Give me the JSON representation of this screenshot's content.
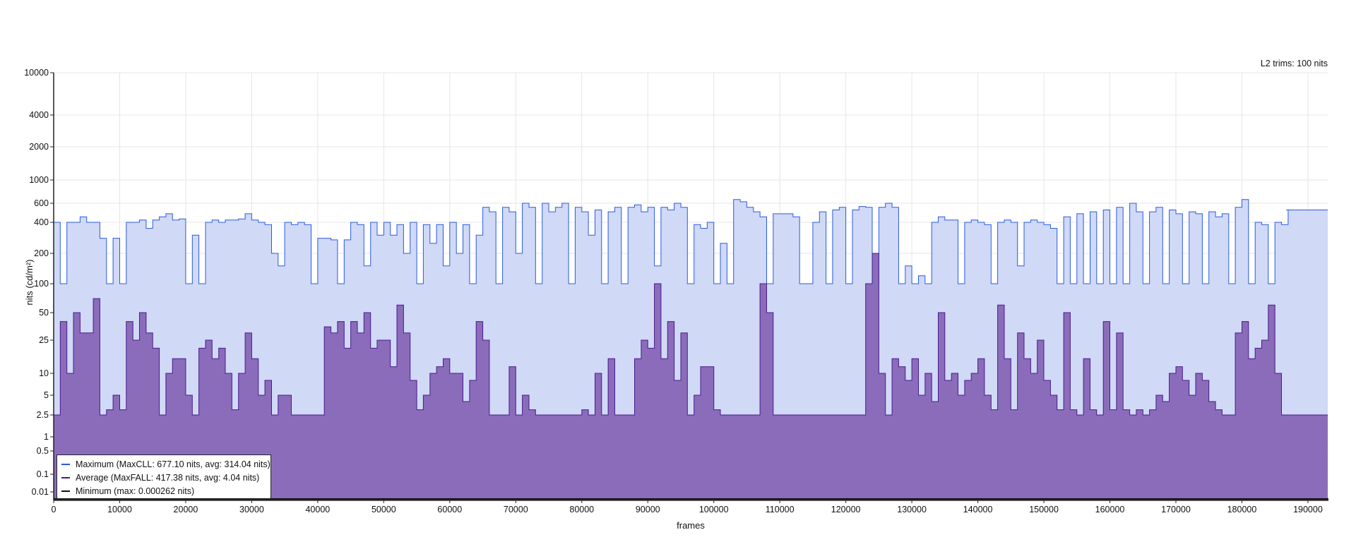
{
  "chart_data": {
    "type": "area",
    "title": "",
    "annotation": "L2 trims: 100 nits",
    "xlabel": "frames",
    "ylabel": "nits (cd/m²)",
    "xlim": [
      0,
      193000
    ],
    "x_ticks": [
      0,
      10000,
      20000,
      30000,
      40000,
      50000,
      60000,
      70000,
      80000,
      90000,
      100000,
      110000,
      120000,
      130000,
      140000,
      150000,
      160000,
      170000,
      180000,
      190000
    ],
    "y_scale": "perceptual (PQ-like)",
    "y_ticks": [
      "10000",
      "4000",
      "2000",
      "1000",
      "600",
      "400",
      "200",
      "100",
      "50",
      "25",
      "10",
      "5",
      "2.5",
      "1",
      "0.5",
      "0.1",
      "0.01"
    ],
    "grid": true,
    "legend_position": "bottom-left",
    "sample_step_frames": 1000,
    "series": [
      {
        "name": "Maximum (MaxCLL: 677.10 nits, avg: 314.04 nits)",
        "color": "#2a5be0",
        "fill": "#d0d9f6",
        "values": [
          400,
          100,
          400,
          400,
          450,
          400,
          400,
          280,
          100,
          280,
          100,
          400,
          400,
          420,
          350,
          420,
          450,
          480,
          420,
          430,
          100,
          300,
          100,
          400,
          420,
          400,
          420,
          420,
          430,
          480,
          420,
          400,
          380,
          200,
          150,
          400,
          380,
          400,
          380,
          100,
          280,
          280,
          270,
          100,
          270,
          400,
          380,
          150,
          400,
          300,
          400,
          300,
          380,
          200,
          400,
          100,
          380,
          250,
          380,
          150,
          400,
          200,
          380,
          100,
          300,
          550,
          500,
          100,
          550,
          500,
          200,
          600,
          550,
          100,
          600,
          500,
          550,
          600,
          100,
          550,
          500,
          300,
          520,
          100,
          500,
          550,
          100,
          550,
          580,
          500,
          550,
          150,
          550,
          520,
          600,
          550,
          100,
          380,
          350,
          400,
          100,
          250,
          100,
          650,
          620,
          550,
          500,
          450,
          100,
          480,
          480,
          480,
          450,
          100,
          100,
          400,
          500,
          100,
          520,
          550,
          100,
          520,
          560,
          550,
          100,
          550,
          600,
          550,
          100,
          150,
          100,
          120,
          100,
          400,
          450,
          420,
          420,
          100,
          400,
          420,
          400,
          380,
          100,
          400,
          420,
          400,
          150,
          400,
          420,
          400,
          380,
          350,
          100,
          450,
          100,
          480,
          100,
          500,
          100,
          520,
          100,
          550,
          100,
          600,
          500,
          100,
          500,
          550,
          100,
          520,
          480,
          100,
          500,
          480,
          100,
          500,
          450,
          480,
          100,
          550,
          650,
          100,
          400,
          380,
          100,
          400,
          380
        ],
        "tail": {
          "from": 186700,
          "to": 193000,
          "value": 520
        }
      },
      {
        "name": "Average (MaxFALL: 417.38 nits, avg: 4.04 nits)",
        "color": "#4a1a8c",
        "fill": "#8b6cbb",
        "values": [
          2.5,
          40,
          10,
          50,
          30,
          30,
          70,
          2.5,
          3,
          5,
          3,
          40,
          25,
          50,
          30,
          20,
          2.5,
          10,
          15,
          15,
          5,
          2.5,
          20,
          25,
          15,
          20,
          10,
          3,
          10,
          30,
          15,
          5,
          8,
          2.5,
          5,
          5,
          2.5,
          2.5,
          2.5,
          2.5,
          2.5,
          35,
          30,
          40,
          20,
          40,
          30,
          50,
          20,
          25,
          25,
          12,
          60,
          30,
          8,
          3,
          5,
          10,
          12,
          15,
          10,
          10,
          4,
          8,
          40,
          25,
          2.5,
          2.5,
          2.5,
          12,
          2.5,
          5,
          3,
          2.5,
          2.5,
          2.5,
          2.5,
          2.5,
          2.5,
          2.5,
          3,
          2.5,
          10,
          2.5,
          15,
          2.5,
          2.5,
          2.5,
          15,
          25,
          20,
          100,
          15,
          40,
          8,
          30,
          2.5,
          5,
          12,
          12,
          3,
          2.5,
          2.5,
          2.5,
          2.5,
          2.5,
          2.5,
          100,
          50,
          2.5,
          2.5,
          2.5,
          2.5,
          2.5,
          2.5,
          2.5,
          2.5,
          2.5,
          2.5,
          2.5,
          2.5,
          2.5,
          2.5,
          100,
          200,
          10,
          2.5,
          15,
          12,
          8,
          15,
          5,
          10,
          4,
          50,
          8,
          10,
          5,
          8,
          10,
          15,
          5,
          3,
          60,
          15,
          3,
          30,
          15,
          10,
          25,
          8,
          5,
          3,
          50,
          3,
          2.5,
          15,
          3,
          2.5,
          40,
          3,
          30,
          3,
          2.5,
          3,
          2.5,
          3,
          5,
          4,
          10,
          12,
          8,
          5,
          10,
          8,
          4,
          3,
          2.5,
          2.5,
          30,
          40,
          15,
          20,
          25,
          60,
          10
        ],
        "tail": {
          "from": 187000,
          "to": 193000,
          "value": 2.5
        }
      },
      {
        "name": "Minimum (max: 0.000262 nits)",
        "color": "#111111",
        "values": [
          0
        ],
        "tail": {
          "from": 0,
          "to": 193000,
          "value": 0
        }
      }
    ]
  }
}
